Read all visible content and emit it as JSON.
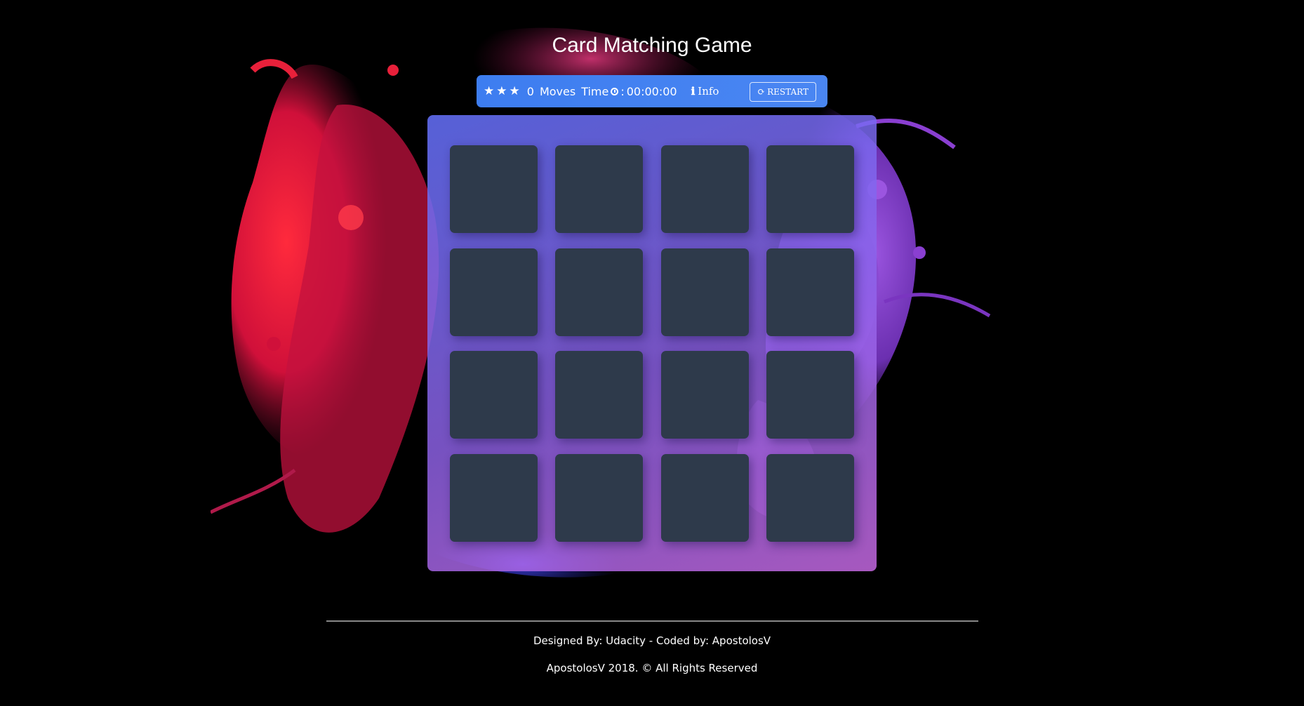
{
  "title": "Card Matching Game",
  "score_panel": {
    "stars": [
      "★",
      "★",
      "★"
    ],
    "moves_count": "0",
    "moves_label": "Moves",
    "time_label": "Time",
    "timer_separator": ":",
    "timer": "00:00:00",
    "info_icon": "ℹ",
    "info_label": "Info",
    "restart_icon": "⟳",
    "restart_label": "RESTART"
  },
  "deck": {
    "rows": 4,
    "columns": 4,
    "card_count": 16,
    "card_color": "#2e3a4b"
  },
  "footer": {
    "credits": "Designed By: Udacity - Coded by: ApostolosV",
    "copyright": "ApostolosV 2018. © All Rights Reserved"
  },
  "colors": {
    "background": "#000000",
    "panel": "#3d7df0",
    "accent_red": "#e8203a",
    "accent_purple": "#8a3fd1"
  }
}
